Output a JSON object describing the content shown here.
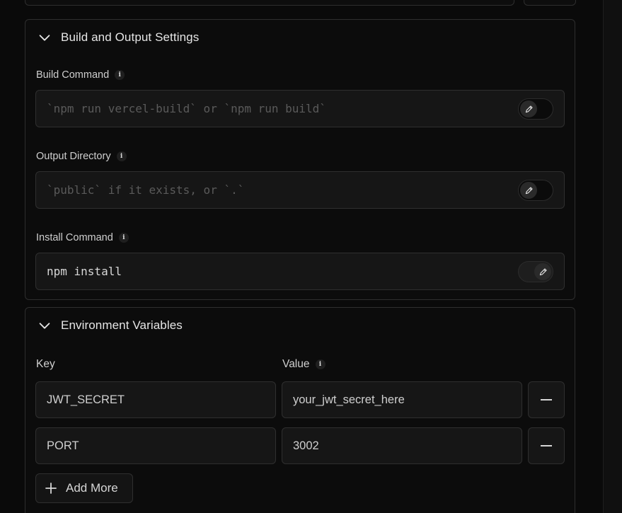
{
  "build_settings": {
    "title": "Build and Output Settings",
    "build_command": {
      "label": "Build Command",
      "placeholder": "`npm run vercel-build` or `npm run build`",
      "value": "",
      "override_enabled": false
    },
    "output_directory": {
      "label": "Output Directory",
      "placeholder": "`public` if it exists, or `.`",
      "value": "",
      "override_enabled": false
    },
    "install_command": {
      "label": "Install Command",
      "placeholder": "",
      "value": "npm install",
      "override_enabled": true
    }
  },
  "env_vars": {
    "title": "Environment Variables",
    "key_label": "Key",
    "value_label": "Value",
    "rows": [
      {
        "key": "JWT_SECRET",
        "value": "your_jwt_secret_here"
      },
      {
        "key": "PORT",
        "value": "3002"
      }
    ],
    "add_more_label": "Add More"
  },
  "icons": {
    "collapse": "chevron-down-icon",
    "info": "info-icon",
    "edit": "pencil-icon",
    "remove": "minus-icon",
    "add": "plus-icon"
  },
  "colors": {
    "background": "#0a0a0a",
    "panel_border": "#2e2e2e",
    "field_bg": "#161616",
    "text": "#ededed",
    "placeholder": "#5a5a5a"
  }
}
